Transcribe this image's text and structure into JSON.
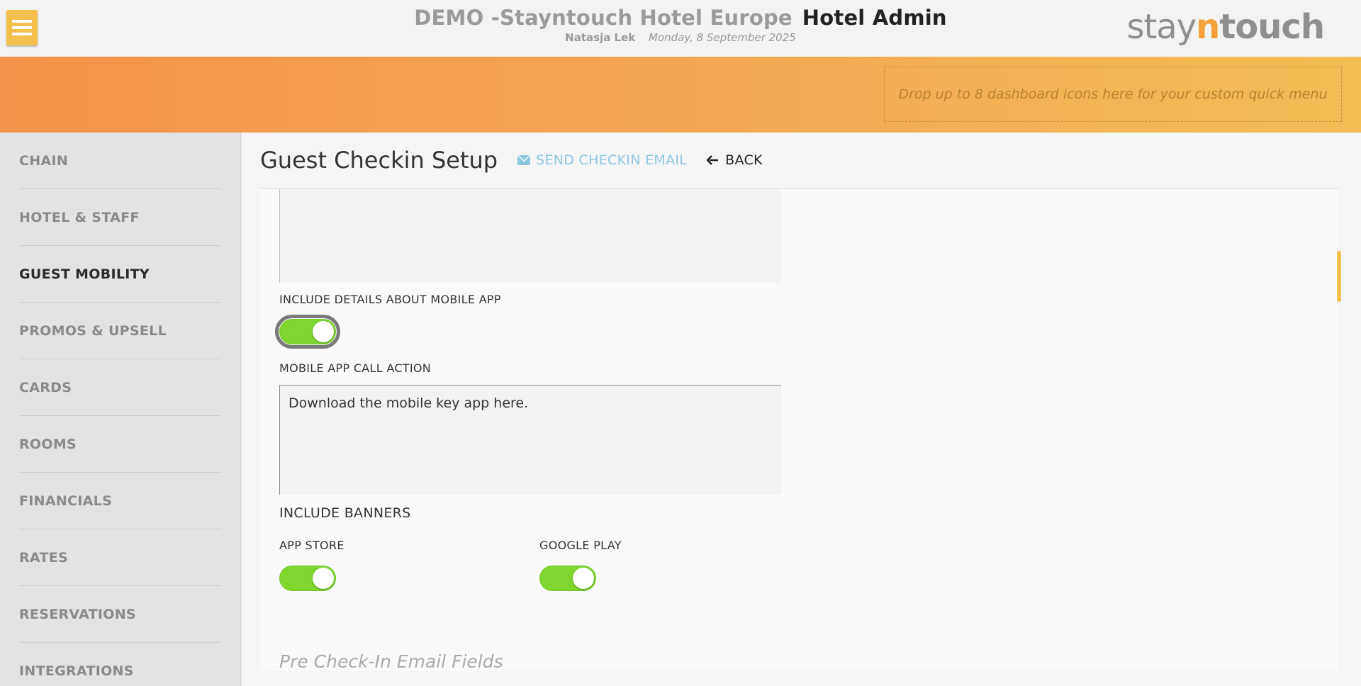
{
  "header": {
    "hotel_name": "DEMO -Stayntouch Hotel Europe",
    "app_title": "Hotel Admin",
    "user": "Natasja Lek",
    "date": "Monday, 8 September 2025",
    "logo": {
      "part1": "stay",
      "part2": "n",
      "part3": "touch"
    }
  },
  "banner": {
    "dropzone_text": "Drop up to 8 dashboard icons here for your custom quick menu"
  },
  "sidebar": {
    "items": [
      {
        "label": "CHAIN"
      },
      {
        "label": "HOTEL & STAFF"
      },
      {
        "label": "GUEST MOBILITY"
      },
      {
        "label": "PROMOS & UPSELL"
      },
      {
        "label": "CARDS"
      },
      {
        "label": "ROOMS"
      },
      {
        "label": "FINANCIALS"
      },
      {
        "label": "RATES"
      },
      {
        "label": "RESERVATIONS"
      },
      {
        "label": "INTEGRATIONS"
      }
    ],
    "active": "GUEST MOBILITY"
  },
  "page": {
    "title": "Guest Checkin Setup",
    "send_email_label": "SEND CHECKIN EMAIL",
    "back_label": "BACK"
  },
  "form": {
    "include_mobile_label": "INCLUDE DETAILS ABOUT MOBILE APP",
    "include_mobile_on": true,
    "cta_label": "MOBILE APP CALL ACTION",
    "cta_value": "Download the mobile key app here.",
    "banners_label": "INCLUDE BANNERS",
    "app_store_label": "APP STORE",
    "app_store_on": true,
    "google_play_label": "GOOGLE PLAY",
    "google_play_on": true,
    "next_section": "Pre Check-In Email Fields"
  },
  "colors": {
    "accent": "#f4c04d",
    "toggle_on": "#7ed62e",
    "link": "#8fc7e0"
  }
}
